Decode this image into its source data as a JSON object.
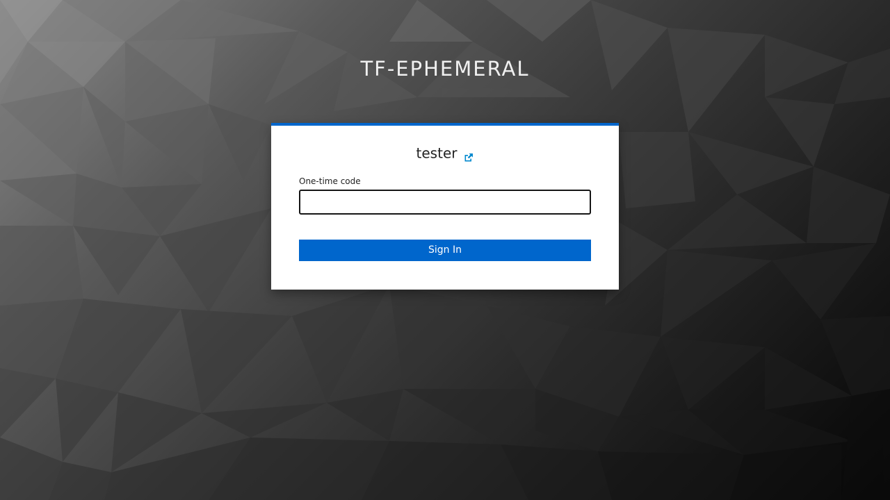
{
  "realm": {
    "title": "TF-EPHEMERAL"
  },
  "login": {
    "username": "tester",
    "restart_icon": "external-link-icon",
    "otp_label": "One-time code",
    "otp_value": "",
    "submit_label": "Sign In"
  },
  "colors": {
    "accent": "#0066cc",
    "card_background": "#ffffff",
    "icon": "#0088ce"
  }
}
